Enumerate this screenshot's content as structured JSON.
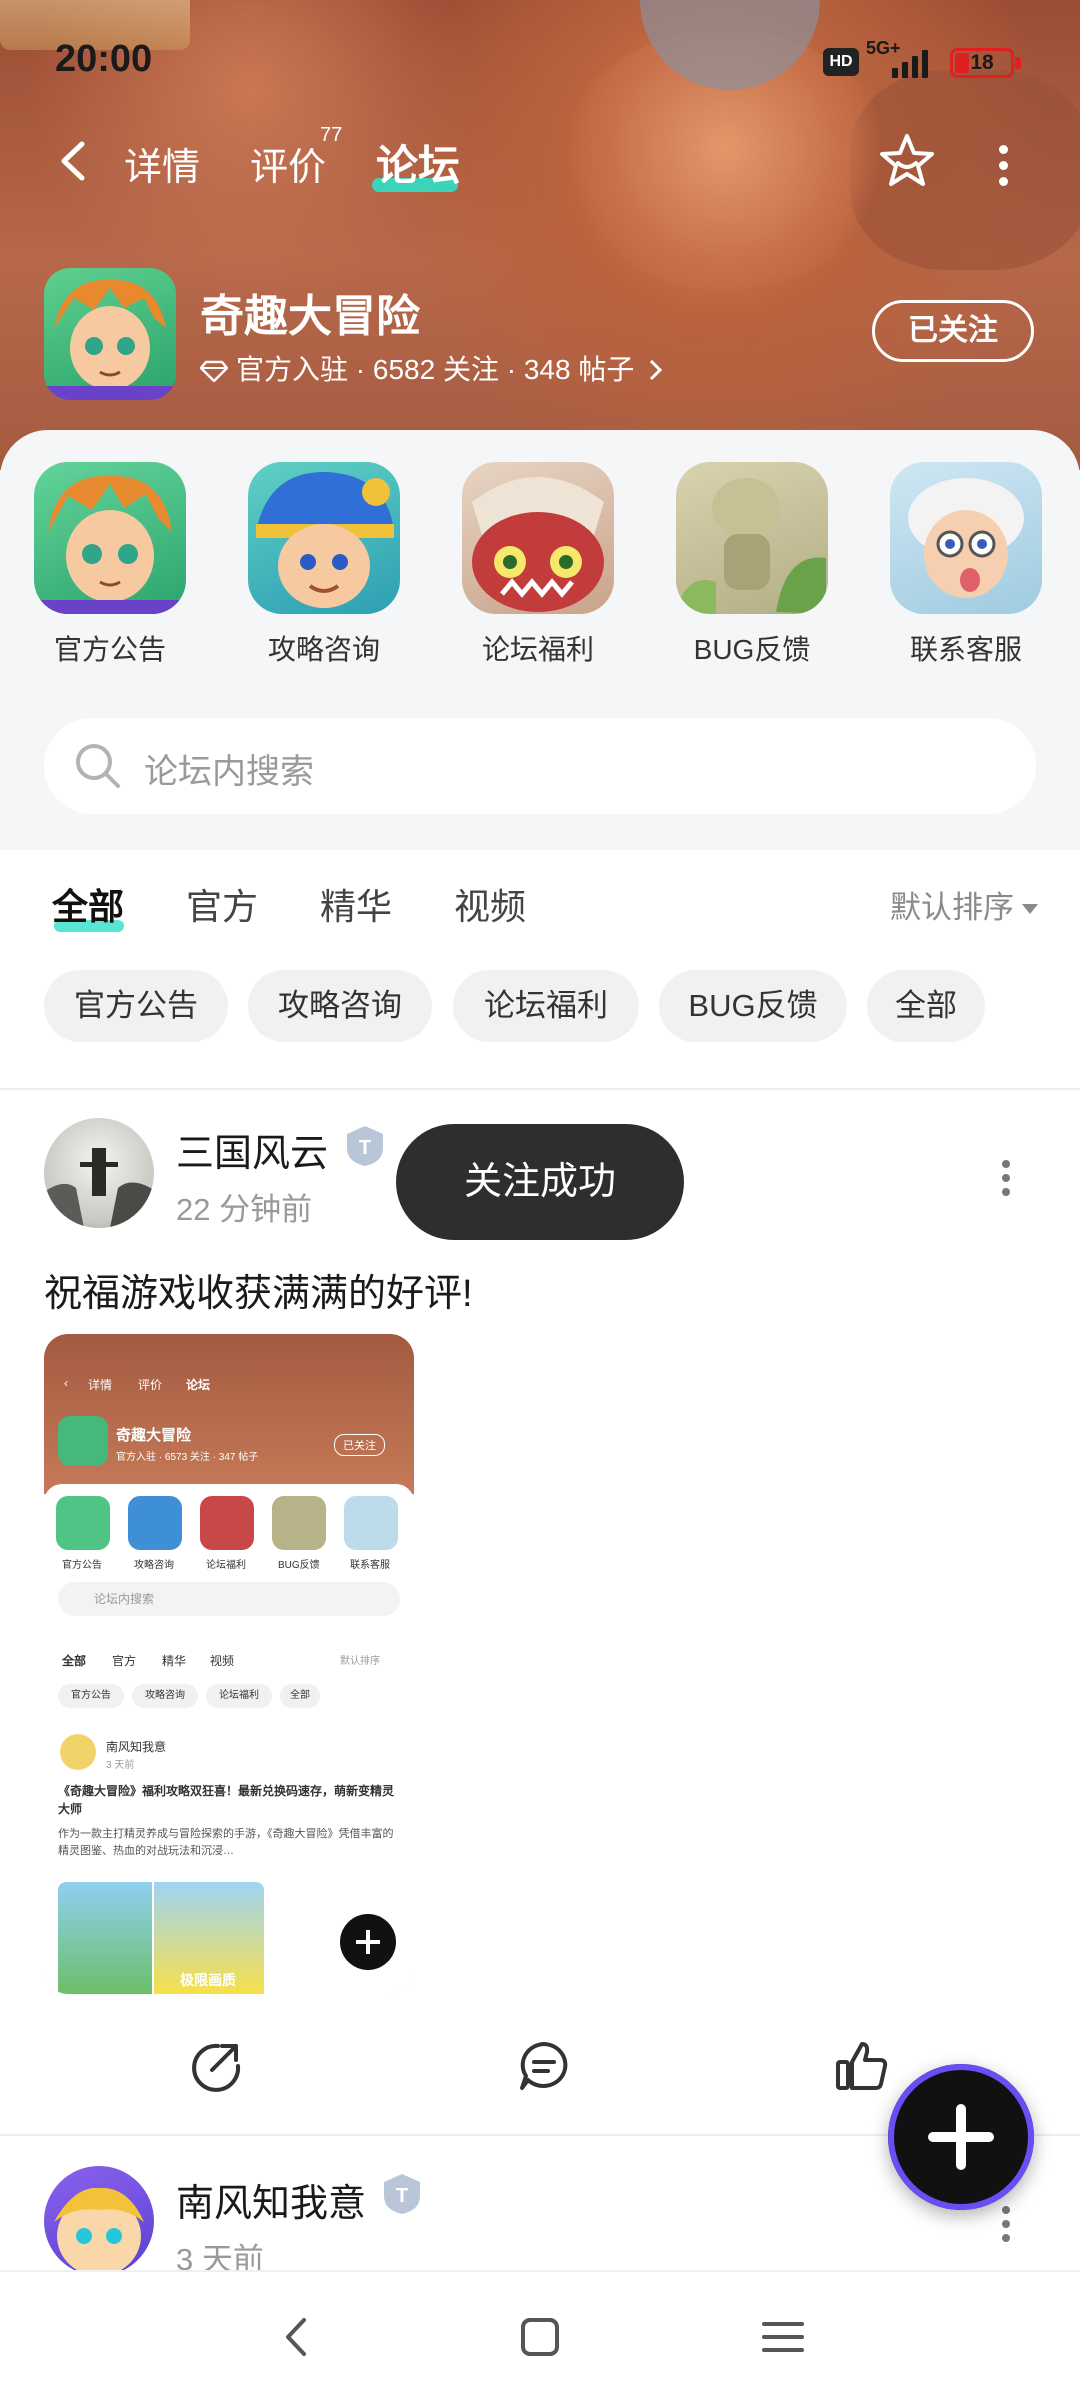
{
  "status_bar": {
    "time": "20:00",
    "hd": "HD",
    "network": "5G+",
    "battery": "18"
  },
  "nav": {
    "tabs": [
      {
        "label": "详情"
      },
      {
        "label": "评价",
        "count": "77"
      },
      {
        "label": "论坛"
      }
    ],
    "active_tab": "论坛"
  },
  "game": {
    "title": "奇趣大冒险",
    "meta": "官方入驻 · 6582 关注 · 348 帖子",
    "follow_label": "已关注"
  },
  "boards": [
    {
      "label": "官方公告"
    },
    {
      "label": "攻略咨询"
    },
    {
      "label": "论坛福利"
    },
    {
      "label": "BUG反馈"
    },
    {
      "label": "联系客服"
    }
  ],
  "search": {
    "placeholder": "论坛内搜索"
  },
  "filters": {
    "tabs": [
      {
        "label": "全部"
      },
      {
        "label": "官方"
      },
      {
        "label": "精华"
      },
      {
        "label": "视频"
      }
    ],
    "sort_label": "默认排序"
  },
  "chips": [
    "官方公告",
    "攻略咨询",
    "论坛福利",
    "BUG反馈",
    "全部"
  ],
  "toast": "关注成功",
  "posts": [
    {
      "author": "三国风云",
      "time": "22 分钟前",
      "text": "祝福游戏收获满满的好评!",
      "screenshot": {
        "tabs": [
          "详情",
          "评价",
          "论坛"
        ],
        "title": "奇趣大冒险",
        "meta": "官方入驻 · 6573 关注 · 347 帖子",
        "follow": "已关注",
        "boards": [
          "官方公告",
          "攻略咨询",
          "论坛福利",
          "BUG反馈",
          "联系客服"
        ],
        "search": "论坛内搜索",
        "filters": [
          "全部",
          "官方",
          "精华",
          "视频"
        ],
        "sort": "默认排序",
        "chips": [
          "官方公告",
          "攻略咨询",
          "论坛福利",
          "全部"
        ],
        "post_author": "南风知我意",
        "post_time": "3 天前",
        "post_title": "《奇趣大冒险》福利攻略双狂喜！最新兑换码速存，萌新变精灵大师",
        "post_body": "作为一款主打精灵养成与冒险探索的手游，《奇趣大冒险》凭借丰富的精灵图鉴、热血的对战玩法和沉浸…",
        "image_text": "极限画质"
      }
    },
    {
      "author": "南风知我意",
      "time": "3 天前"
    }
  ]
}
